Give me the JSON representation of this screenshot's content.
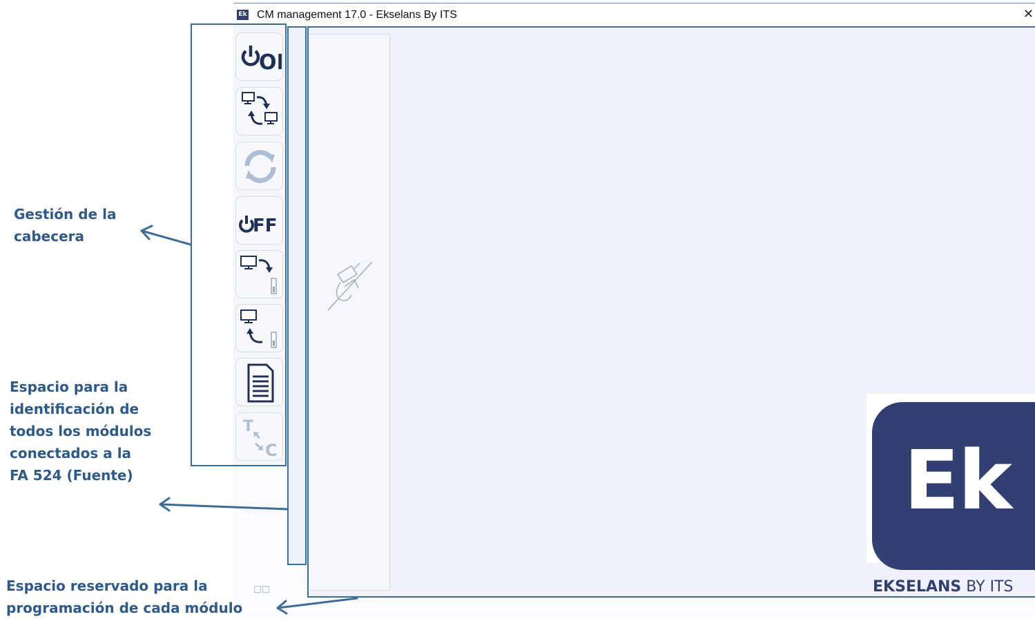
{
  "window": {
    "app_icon_text": "Ek",
    "title": "CM management 17.0 - Ekselans By ITS",
    "close_glyph": "✕"
  },
  "toolbar": {
    "buttons": [
      {
        "icon": "power-on-icon",
        "label": "ON",
        "enabled": true
      },
      {
        "icon": "transfer-pc-icon",
        "enabled": true
      },
      {
        "icon": "refresh-icon",
        "enabled": false
      },
      {
        "icon": "power-off-icon",
        "label": "FF",
        "enabled": true
      },
      {
        "icon": "upload-to-module-icon",
        "enabled": true
      },
      {
        "icon": "download-from-module-icon",
        "enabled": true
      },
      {
        "icon": "report-icon",
        "enabled": true
      },
      {
        "icon": "tc-swap-icon",
        "t_label": "T",
        "c_label": "C",
        "enabled": false
      }
    ]
  },
  "logo": {
    "letters": "Ek",
    "caption_bold": "EKSELANS",
    "caption_light": " BY ITS"
  },
  "annotations": {
    "header_management": [
      "Gestión de la",
      "cabecera"
    ],
    "modules_identification": [
      "Espacio para la",
      "identificación de",
      "todos los módulos",
      "conectados a la",
      "FA 524 (Fuente)"
    ],
    "module_programming": [
      "Espacio reservado para la",
      "programación de cada módulo"
    ]
  },
  "colors": {
    "annotation": "#2f5a88",
    "brand_dark": "#314070",
    "toolbar_icon": "#1f2f55",
    "disabled_icon": "#aebed3"
  }
}
